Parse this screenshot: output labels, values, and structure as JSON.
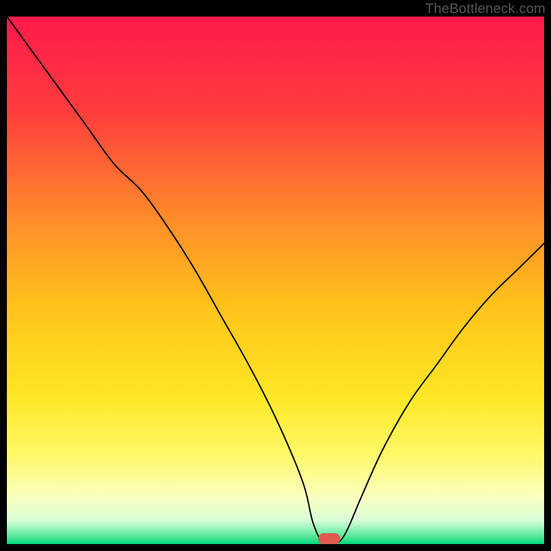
{
  "watermark": "TheBottleneck.com",
  "chart_data": {
    "type": "line",
    "title": "",
    "xlabel": "",
    "ylabel": "",
    "xlim": [
      0,
      100
    ],
    "ylim": [
      0,
      100
    ],
    "gradient_stops": [
      {
        "offset": 0,
        "color": "#ff1a4b"
      },
      {
        "offset": 0.18,
        "color": "#ff3d3d"
      },
      {
        "offset": 0.38,
        "color": "#ff8a2a"
      },
      {
        "offset": 0.55,
        "color": "#ffc31a"
      },
      {
        "offset": 0.72,
        "color": "#ffe725"
      },
      {
        "offset": 0.83,
        "color": "#fff968"
      },
      {
        "offset": 0.91,
        "color": "#fbffbf"
      },
      {
        "offset": 0.955,
        "color": "#d9ffd9"
      },
      {
        "offset": 0.985,
        "color": "#57e89a"
      },
      {
        "offset": 1.0,
        "color": "#00d77a"
      }
    ],
    "series": [
      {
        "name": "bottleneck-curve",
        "x": [
          0,
          5,
          10,
          15,
          20,
          25,
          30,
          35,
          40,
          45,
          50,
          55,
          57,
          59,
          61,
          63,
          66,
          70,
          75,
          80,
          85,
          90,
          95,
          100
        ],
        "y": [
          100,
          93,
          86,
          79,
          72,
          67,
          60,
          52,
          43,
          34,
          24,
          12,
          4,
          0,
          0,
          2,
          9,
          18,
          27,
          34,
          41,
          47,
          52,
          57
        ]
      }
    ],
    "marker": {
      "x": 60,
      "y": 0,
      "width": 4,
      "height": 2
    }
  }
}
